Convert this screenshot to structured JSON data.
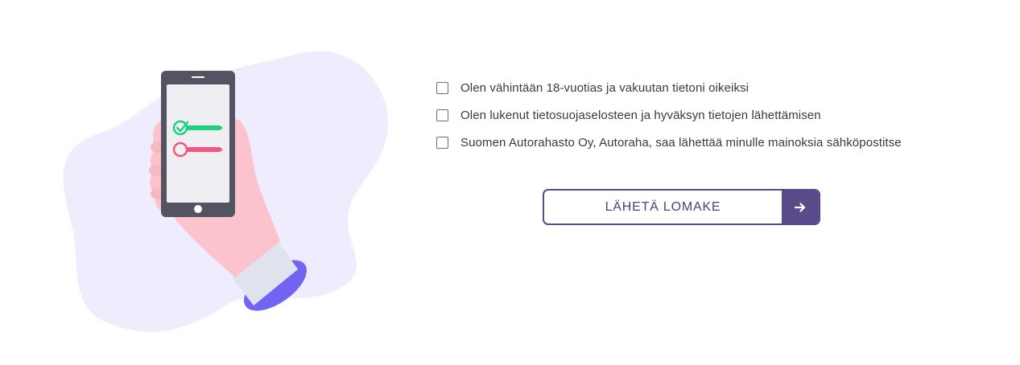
{
  "consents": [
    {
      "label": "Olen vähintään 18-vuotias ja vakuutan tietoni oikeiksi",
      "checked": false
    },
    {
      "label": "Olen lukenut tietosuojaselosteen ja hyväksyn tietojen lähettämisen",
      "checked": false
    },
    {
      "label": "Suomen Autorahasto Oy, Autoraha, saa lähettää minulle mainoksia sähköpostitse",
      "checked": false
    }
  ],
  "submit": {
    "label": "LÄHETÄ LOMAKE",
    "icon": "arrow-right-icon"
  },
  "illustration": {
    "icon": "hand-holding-phone-checklist-illustration"
  },
  "colors": {
    "accent": "#5b4a8a",
    "blob": "#efedfd",
    "check_green": "#1ed07f",
    "pink": "#f2557e",
    "skin": "#fbc3cb",
    "phone": "#545361",
    "cuff": "#7064f0"
  }
}
